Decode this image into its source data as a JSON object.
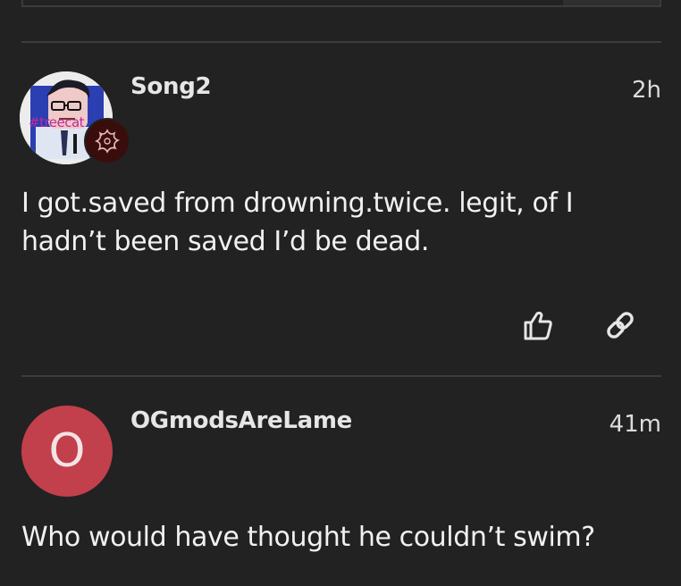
{
  "posts": [
    {
      "username": "Song2",
      "time": "2h",
      "avatar": {
        "type": "image",
        "overlay_text": "#treecat",
        "badge_icon": "splat-flower-icon",
        "badge_color": "#3a0d0d"
      },
      "body": "I got.saved from drowning.twice. legit, of I hadn’t been saved I’d be dead.",
      "actions": [
        "like-icon",
        "link-icon"
      ]
    },
    {
      "username": "OGmodsAreLame",
      "time": "41m",
      "avatar": {
        "type": "letter",
        "letter": "O",
        "color": "#c2404b"
      },
      "body": "Who would have thought he couldn’t swim?"
    }
  ]
}
